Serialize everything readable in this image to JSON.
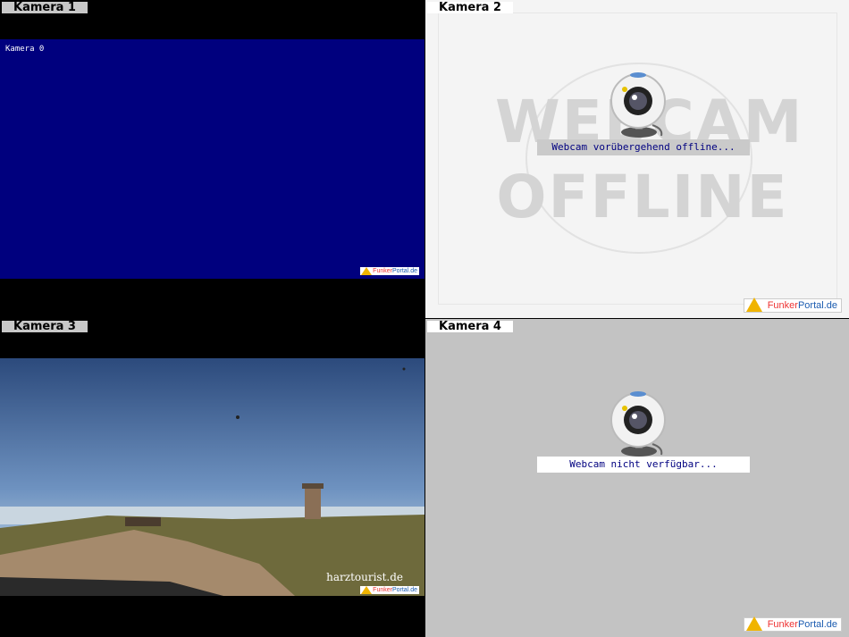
{
  "cameras": [
    {
      "label": "Kamera 1",
      "overlay_text": "Kamera 0"
    },
    {
      "label": "Kamera 2",
      "bg_line1": "WEBCAM",
      "bg_line2": "OFFLINE",
      "message": "Webcam vorübergehend offline..."
    },
    {
      "label": "Kamera 3",
      "credit": "harztourist.de"
    },
    {
      "label": "Kamera 4",
      "message": "Webcam nicht verfügbar..."
    }
  ],
  "watermark": {
    "part1": "Funker",
    "part2": "Portal",
    "part3": ".de"
  },
  "colors": {
    "blue_screen": "#00007e",
    "accent_yellow": "#f0b400",
    "message_text": "#000080"
  }
}
